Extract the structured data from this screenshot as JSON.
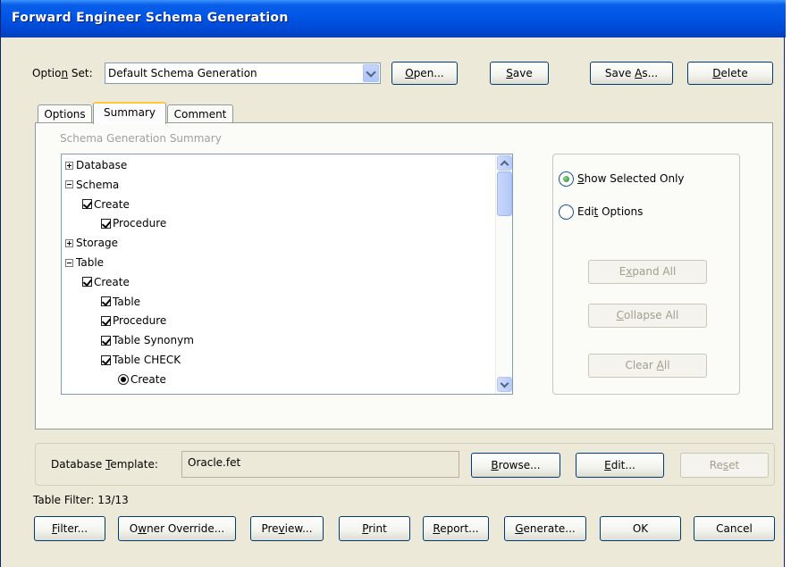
{
  "window": {
    "title": "Forward Engineer Schema Generation"
  },
  "option_set": {
    "label_pre": "Optio",
    "label_key": "n",
    "label_post": " Set:",
    "value": "Default Schema Generation",
    "open_button": {
      "key": "O",
      "rest": "pen..."
    },
    "save_button": {
      "key": "S",
      "rest": "ave"
    },
    "save_as_button": {
      "pre": "Save ",
      "key": "A",
      "post": "s..."
    },
    "delete_button": {
      "key": "D",
      "rest": "elete"
    }
  },
  "tabs": [
    {
      "label": "Options",
      "active": false
    },
    {
      "label": "Summary",
      "active": true
    },
    {
      "label": "Comment",
      "active": false
    }
  ],
  "summary": {
    "group_title": "Schema Generation Summary",
    "tree": [
      {
        "label": "Database",
        "level": 0,
        "kind": "plus"
      },
      {
        "label": "Schema",
        "level": 0,
        "kind": "minus"
      },
      {
        "label": "Create",
        "level": 1,
        "kind": "check"
      },
      {
        "label": "Procedure",
        "level": 2,
        "kind": "check"
      },
      {
        "label": "Storage",
        "level": 0,
        "kind": "plus"
      },
      {
        "label": "Table",
        "level": 0,
        "kind": "minus"
      },
      {
        "label": "Create",
        "level": 1,
        "kind": "check"
      },
      {
        "label": "Table",
        "level": 2,
        "kind": "check"
      },
      {
        "label": "Procedure",
        "level": 2,
        "kind": "check"
      },
      {
        "label": "Table Synonym",
        "level": 2,
        "kind": "check"
      },
      {
        "label": "Table CHECK",
        "level": 2,
        "kind": "check"
      },
      {
        "label": "Create",
        "level": 3,
        "kind": "radio"
      }
    ],
    "show_selected_only": {
      "key": "S",
      "rest": "how Selected Only",
      "selected": true
    },
    "edit_options": {
      "pre": "Edi",
      "key": "t",
      "post": " Options",
      "selected": false
    },
    "expand_all": {
      "pre": "E",
      "key": "x",
      "post": "pand All"
    },
    "collapse_all": {
      "key": "C",
      "rest": "ollapse All"
    },
    "clear_all": {
      "pre": "Clear ",
      "key": "A",
      "post": "ll"
    }
  },
  "database_template": {
    "label_pre": "Database ",
    "label_key": "T",
    "label_post": "emplate:",
    "value": "Oracle.fet",
    "browse_button": {
      "key": "B",
      "rest": "rowse..."
    },
    "edit_button": {
      "key": "E",
      "rest": "dit..."
    },
    "reset_button": {
      "pre": "Re",
      "key": "s",
      "post": "et"
    }
  },
  "table_filter": "Table Filter: 13/13",
  "bottom_buttons": {
    "filter": {
      "key": "F",
      "rest": "ilter..."
    },
    "owner_override": {
      "pre": "O",
      "key": "w",
      "post": "ner Override..."
    },
    "preview": {
      "pre": "Pre",
      "key": "v",
      "post": "iew..."
    },
    "print": {
      "key": "P",
      "rest": "rint"
    },
    "report": {
      "key": "R",
      "rest": "eport..."
    },
    "generate": {
      "key": "G",
      "rest": "enerate..."
    },
    "ok": "OK",
    "cancel": "Cancel"
  }
}
